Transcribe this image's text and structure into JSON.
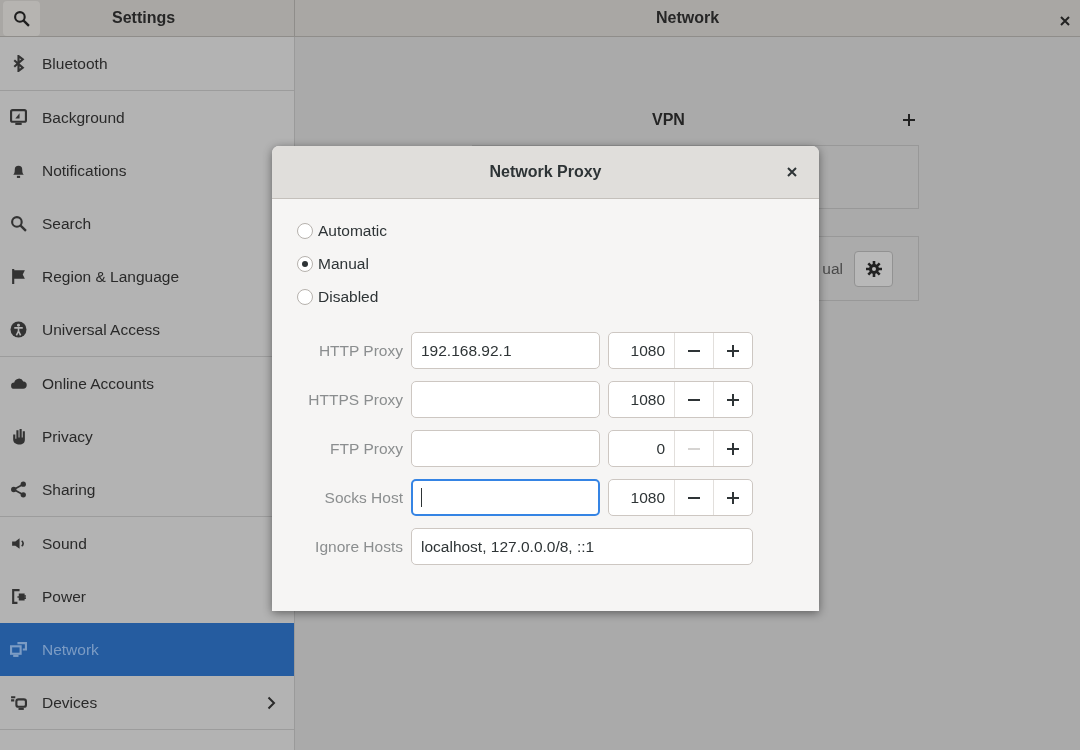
{
  "header": {
    "sidebar_title": "Settings",
    "title": "Network"
  },
  "sidebar": {
    "items": [
      {
        "label": "Bluetooth",
        "selected": false
      },
      {
        "label": "Background",
        "selected": false
      },
      {
        "label": "Notifications",
        "selected": false
      },
      {
        "label": "Search",
        "selected": false
      },
      {
        "label": "Region & Language",
        "selected": false
      },
      {
        "label": "Universal Access",
        "selected": false
      },
      {
        "label": "Online Accounts",
        "selected": false
      },
      {
        "label": "Privacy",
        "selected": false
      },
      {
        "label": "Sharing",
        "selected": false
      },
      {
        "label": "Sound",
        "selected": false
      },
      {
        "label": "Power",
        "selected": false
      },
      {
        "label": "Network",
        "selected": true
      },
      {
        "label": "Devices",
        "selected": false,
        "has_submenu": true
      }
    ]
  },
  "network": {
    "vpn_title": "VPN",
    "proxy_row_text": "ual"
  },
  "dialog": {
    "title": "Network Proxy",
    "modes": [
      {
        "label": "Automatic",
        "selected": false
      },
      {
        "label": "Manual",
        "selected": true
      },
      {
        "label": "Disabled",
        "selected": false
      }
    ],
    "proxies": [
      {
        "label": "HTTP Proxy",
        "host": "192.168.92.1",
        "focused": false,
        "port": "1080",
        "minus_disabled": false
      },
      {
        "label": "HTTPS Proxy",
        "focused": false,
        "port": "1080",
        "minus_disabled": false
      },
      {
        "label": "FTP Proxy",
        "focused": false,
        "port": "0",
        "minus_disabled": true
      },
      {
        "label": "Socks Host",
        "focused": true,
        "port": "1080",
        "minus_disabled": false
      }
    ],
    "ignore_hosts": {
      "label": "Ignore Hosts",
      "value": "localhost, 127.0.0.0/8, ::1"
    }
  }
}
